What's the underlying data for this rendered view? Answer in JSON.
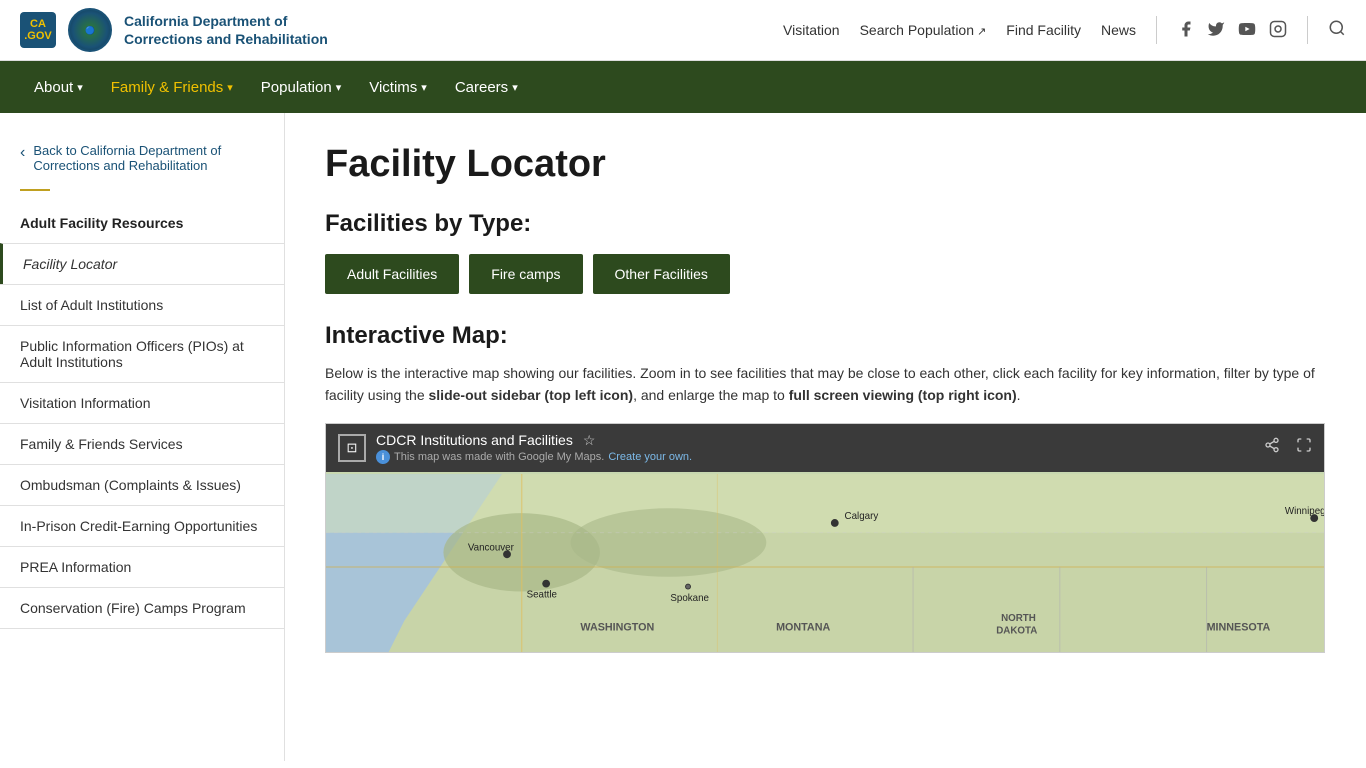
{
  "header": {
    "logo_ca_text": "CA\n.GOV",
    "org_name_line1": "California Department of",
    "org_name_line2": "Corrections and Rehabilitation",
    "nav_links": [
      {
        "label": "Visitation",
        "external": false
      },
      {
        "label": "Search Population",
        "external": true
      },
      {
        "label": "Find Facility",
        "external": false
      },
      {
        "label": "News",
        "external": false
      }
    ],
    "social": [
      "f",
      "𝕏",
      "▶",
      "📷"
    ],
    "search_tooltip": "Search"
  },
  "main_nav": {
    "items": [
      {
        "label": "About",
        "active": false
      },
      {
        "label": "Family & Friends",
        "active": true
      },
      {
        "label": "Population",
        "active": false
      },
      {
        "label": "Victims",
        "active": false
      },
      {
        "label": "Careers",
        "active": false
      }
    ]
  },
  "sidebar": {
    "back_label": "Back to California Department of Corrections and Rehabilitation",
    "section_title": "Adult Facility Resources",
    "items": [
      {
        "label": "Facility Locator",
        "active": true
      },
      {
        "label": "List of Adult Institutions",
        "active": false
      },
      {
        "label": "Public Information Officers (PIOs) at Adult Institutions",
        "active": false
      },
      {
        "label": "Visitation Information",
        "active": false
      },
      {
        "label": "Family & Friends Services",
        "active": false
      },
      {
        "label": "Ombudsman (Complaints & Issues)",
        "active": false
      },
      {
        "label": "In-Prison Credit-Earning Opportunities",
        "active": false
      },
      {
        "label": "PREA Information",
        "active": false
      },
      {
        "label": "Conservation (Fire) Camps Program",
        "active": false
      }
    ]
  },
  "content": {
    "page_title": "Facility Locator",
    "facilities_section_title": "Facilities by Type:",
    "facility_buttons": [
      {
        "label": "Adult Facilities"
      },
      {
        "label": "Fire camps"
      },
      {
        "label": "Other Facilities"
      }
    ],
    "map_section_title": "Interactive Map:",
    "map_description_start": "Below is the interactive map showing our facilities. Zoom in to see facilities that may be close to each other, click each facility for key information, filter by type of facility using the ",
    "map_desc_bold1": "slide-out sidebar (top left icon)",
    "map_desc_mid": ", and enlarge the map to ",
    "map_desc_bold2": "full screen viewing (top right icon)",
    "map_desc_end": ".",
    "map_title": "CDCR Institutions and Facilities",
    "map_subtitle": "This map was made with Google My Maps.",
    "map_create_link": "Create your own.",
    "map_labels": {
      "calgary": "Calgary",
      "winnipeg": "Winnipeg",
      "vancouver": "Vancouver",
      "seattle": "Seattle",
      "spokane": "Spokane",
      "washington": "WASHINGTON",
      "montana": "MONTANA",
      "north_dakota": "NORTH DAKOTA",
      "minnesota": "MINNESOTA"
    }
  }
}
